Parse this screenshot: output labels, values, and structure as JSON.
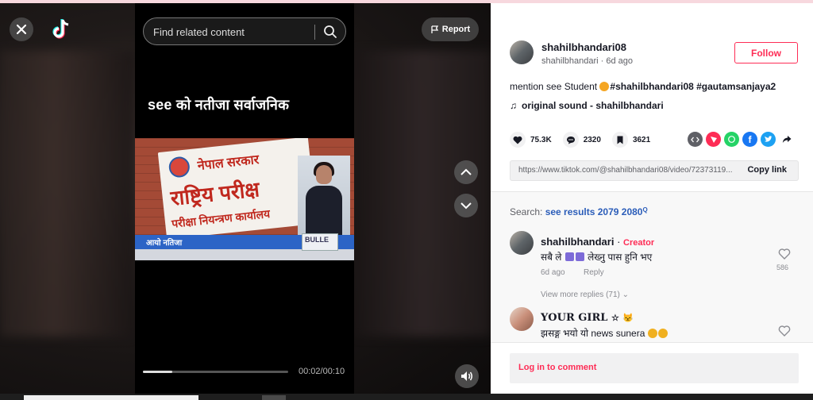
{
  "video": {
    "headline": "see को नतीजा सर्वाजनिक",
    "sign_line1": "नेपाल सरकार",
    "sign_line2": "राष्ट्रिय परीक्ष",
    "sign_line3": "परीक्षा नियन्त्रण कार्यालय",
    "ticker_text": "आयो नतिजा",
    "ticker_badge": "BULLE",
    "time": "00:02/00:10",
    "progress_fraction": 0.2
  },
  "overlay": {
    "search_placeholder": "Find related content",
    "report_label": "Report"
  },
  "author": {
    "username": "shahilbhandari08",
    "handle": "shahilbhandari",
    "age": "6d ago",
    "follow_label": "Follow"
  },
  "post": {
    "desc_prefix": "mention see Student ",
    "desc_tags": "#shahilbhandari08 #gautamsanjaya2",
    "sound": "original sound - shahilbhandari"
  },
  "stats": {
    "likes": "75.3K",
    "comments": "2320",
    "saves": "3621"
  },
  "share": {
    "url": "https://www.tiktok.com/@shahilbhandari08/video/72373119...",
    "copy_label": "Copy link"
  },
  "comments": {
    "search_label": "Search:",
    "search_query": "see results 2079 2080",
    "items": [
      {
        "name": "shahilbhandari",
        "creator_tag": "Creator",
        "text_a": "सबै ले",
        "text_b": "लेख्नु पास हुनि भए",
        "age": "6d ago",
        "reply_label": "Reply",
        "likes": "586"
      },
      {
        "name": "YOUR GIRL",
        "text": "झसङ्ग भयो यो news sunera"
      }
    ],
    "view_more": "View more replies (71)"
  },
  "login_label": "Log in to comment",
  "colors": {
    "accent": "#fe2c55",
    "link": "#2b5db9"
  }
}
